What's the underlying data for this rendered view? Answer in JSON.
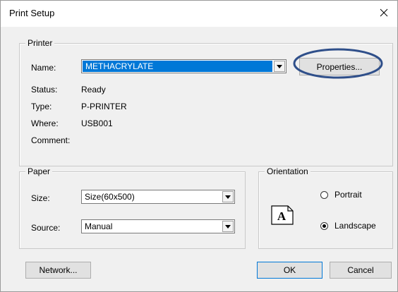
{
  "window": {
    "title": "Print Setup",
    "close_glyph": "✕"
  },
  "printer": {
    "group_title": "Printer",
    "name_label": "Name:",
    "name_value": "METHACRYLATE",
    "properties_label": "Properties...",
    "status_label": "Status:",
    "status_value": "Ready",
    "type_label": "Type:",
    "type_value": "P-PRINTER",
    "where_label": "Where:",
    "where_value": "USB001",
    "comment_label": "Comment:",
    "comment_value": ""
  },
  "paper": {
    "group_title": "Paper",
    "size_label": "Size:",
    "size_value": "Size(60x500)",
    "source_label": "Source:",
    "source_value": "Manual"
  },
  "orientation": {
    "group_title": "Orientation",
    "portrait_label": "Portrait",
    "landscape_label": "Landscape",
    "selected": "Landscape",
    "icon_letter": "A"
  },
  "buttons": {
    "network_label": "Network...",
    "ok_label": "OK",
    "cancel_label": "Cancel"
  },
  "annotation": {
    "color": "#2f4f8a"
  }
}
